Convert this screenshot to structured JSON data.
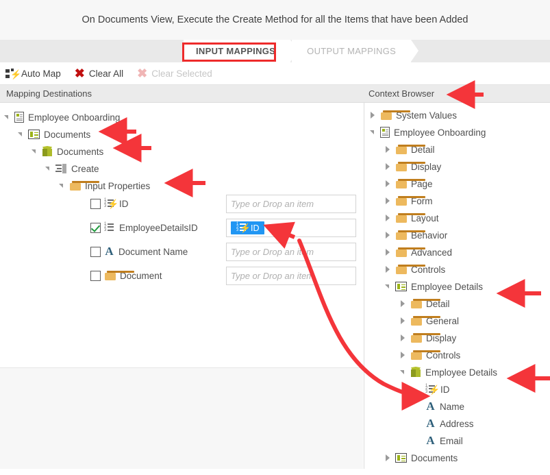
{
  "header": {
    "title": "On Documents View, Execute the Create Method for all the Items that have been Added"
  },
  "tabs": [
    {
      "label": "INPUT MAPPINGS",
      "active": true
    },
    {
      "label": "OUTPUT MAPPINGS",
      "active": false
    }
  ],
  "toolbar": {
    "auto_map_label": "Auto Map",
    "clear_all_label": "Clear All",
    "clear_selected_label": "Clear Selected"
  },
  "columns": {
    "mapping_destinations_label": "Mapping Destinations",
    "context_browser_label": "Context Browser"
  },
  "mapping_destinations": {
    "tree": [
      {
        "label": "Employee Onboarding",
        "icon": "form-doc-icon",
        "indent": 0,
        "state": "open"
      },
      {
        "label": "Documents",
        "icon": "view-icon",
        "indent": 1,
        "state": "open"
      },
      {
        "label": "Documents",
        "icon": "smartobject-cube-icon",
        "indent": 2,
        "state": "open"
      },
      {
        "label": "Create",
        "icon": "method-icon",
        "indent": 3,
        "state": "open"
      },
      {
        "label": "Input Properties",
        "icon": "folder-icon",
        "indent": 4,
        "state": "open"
      }
    ],
    "properties": [
      {
        "label": "ID",
        "icon": "autonumber-icon",
        "checked": false,
        "value": "",
        "placeholder": "Type or Drop an item"
      },
      {
        "label": "EmployeeDetailsID",
        "icon": "number-icon",
        "checked": true,
        "value": "ID",
        "value_icon": "autonumber-icon",
        "placeholder": "Type or Drop an item"
      },
      {
        "label": "Document Name",
        "icon": "text-icon",
        "checked": false,
        "value": "",
        "placeholder": "Type or Drop an item"
      },
      {
        "label": "Document",
        "icon": "folder-icon",
        "checked": false,
        "value": "",
        "placeholder": "Type or Drop an item"
      }
    ]
  },
  "context_browser": {
    "tree": [
      {
        "label": "System Values",
        "icon": "folder-icon",
        "indent": 0,
        "state": "closed"
      },
      {
        "label": "Employee Onboarding",
        "icon": "form-doc-icon",
        "indent": 0,
        "state": "open"
      },
      {
        "label": "Detail",
        "icon": "folder-icon",
        "indent": 1,
        "state": "closed"
      },
      {
        "label": "Display",
        "icon": "folder-icon",
        "indent": 1,
        "state": "closed"
      },
      {
        "label": "Page",
        "icon": "folder-icon",
        "indent": 1,
        "state": "closed"
      },
      {
        "label": "Form",
        "icon": "folder-icon",
        "indent": 1,
        "state": "closed"
      },
      {
        "label": "Layout",
        "icon": "folder-icon",
        "indent": 1,
        "state": "closed"
      },
      {
        "label": "Behavior",
        "icon": "folder-icon",
        "indent": 1,
        "state": "closed"
      },
      {
        "label": "Advanced",
        "icon": "folder-icon",
        "indent": 1,
        "state": "closed"
      },
      {
        "label": "Controls",
        "icon": "folder-icon",
        "indent": 1,
        "state": "closed"
      },
      {
        "label": "Employee Details",
        "icon": "view-icon",
        "indent": 1,
        "state": "open"
      },
      {
        "label": "Detail",
        "icon": "folder-icon",
        "indent": 2,
        "state": "closed"
      },
      {
        "label": "General",
        "icon": "folder-icon",
        "indent": 2,
        "state": "closed"
      },
      {
        "label": "Display",
        "icon": "folder-icon",
        "indent": 2,
        "state": "closed"
      },
      {
        "label": "Controls",
        "icon": "folder-icon",
        "indent": 2,
        "state": "closed"
      },
      {
        "label": "Employee Details",
        "icon": "smartobject-cube-icon",
        "indent": 2,
        "state": "open"
      },
      {
        "label": "ID",
        "icon": "autonumber-icon",
        "indent": 3,
        "state": "leaf"
      },
      {
        "label": "Name",
        "icon": "text-icon",
        "indent": 3,
        "state": "leaf"
      },
      {
        "label": "Address",
        "icon": "text-icon",
        "indent": 3,
        "state": "leaf"
      },
      {
        "label": "Email",
        "icon": "text-icon",
        "indent": 3,
        "state": "leaf"
      },
      {
        "label": "Documents",
        "icon": "view-icon",
        "indent": 1,
        "state": "closed"
      }
    ]
  },
  "annotations": {
    "color": "#f4353a",
    "highlight_color": "#ee2b2b",
    "arrow_targets": [
      "mapping-destinations-documents-view",
      "mapping-destinations-documents-smartobject",
      "mapping-destinations-input-properties",
      "employeedetailsid-value-chip",
      "context-browser-label",
      "context-employee-details-view",
      "context-employee-details-smartobject",
      "context-employee-details-id"
    ],
    "curve_from": "employeedetailsid-value-chip",
    "curve_to": "context-employee-details-id"
  },
  "colors": {
    "accent_blue": "#2196f3",
    "annotation_red": "#f4353a",
    "check_green": "#1f9a3d",
    "folder_orange": "#edb95e",
    "cube_olive": "#aebb2a"
  }
}
